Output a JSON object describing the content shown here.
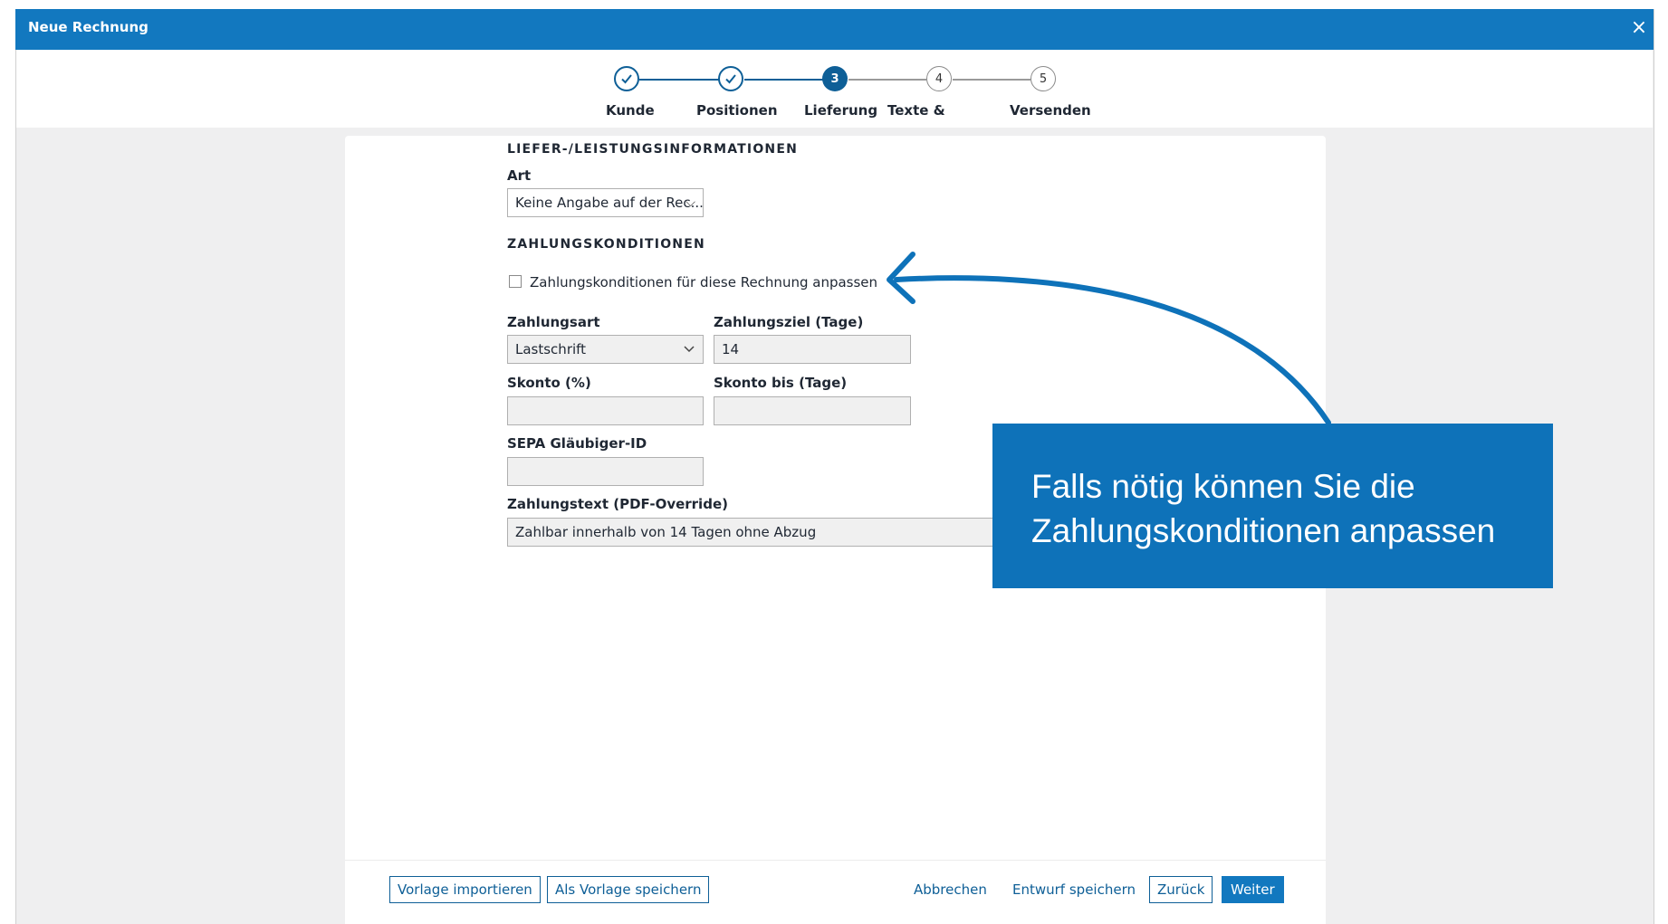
{
  "window": {
    "title": "Neue Rechnung",
    "close_icon": "×"
  },
  "stepper": {
    "steps": [
      {
        "label": "Kunde",
        "state": "done",
        "number": ""
      },
      {
        "label": "Positionen",
        "state": "done",
        "number": ""
      },
      {
        "label": "Lieferung",
        "state": "active",
        "number": "3"
      },
      {
        "label": "Texte &",
        "state": "todo",
        "number": "4"
      },
      {
        "label": "Versenden",
        "state": "todo",
        "number": "5"
      }
    ],
    "accent_color": "#0e5f97"
  },
  "form": {
    "delivery_section_title": "LIEFER-/LEISTUNGSINFORMATIONEN",
    "art": {
      "label": "Art",
      "value": "Keine Angabe auf der Rec..."
    },
    "payment_section_title": "ZAHLUNGSKONDITIONEN",
    "customize_checkbox": {
      "label": "Zahlungskonditionen für diese Rechnung anpassen",
      "checked": false
    },
    "zahlungsart": {
      "label": "Zahlungsart",
      "value": "Lastschrift"
    },
    "zahlungsziel": {
      "label": "Zahlungsziel (Tage)",
      "value": "14"
    },
    "skonto": {
      "label": "Skonto (%)",
      "value": ""
    },
    "skonto_bis": {
      "label": "Skonto bis (Tage)",
      "value": ""
    },
    "sepa": {
      "label": "SEPA Gläubiger-ID",
      "value": ""
    },
    "zahlungstext": {
      "label": "Zahlungstext (PDF-Override)",
      "value": "Zahlbar innerhalb von 14 Tagen ohne Abzug"
    }
  },
  "footer": {
    "import_template": "Vorlage importieren",
    "save_template": "Als Vorlage speichern",
    "cancel": "Abbrechen",
    "save_draft": "Entwurf speichern",
    "back": "Zurück",
    "next": "Weiter"
  },
  "callout": {
    "line1": "Falls nötig können Sie die",
    "line2": "Zahlungskonditionen anpassen",
    "color": "#0e72b9"
  }
}
